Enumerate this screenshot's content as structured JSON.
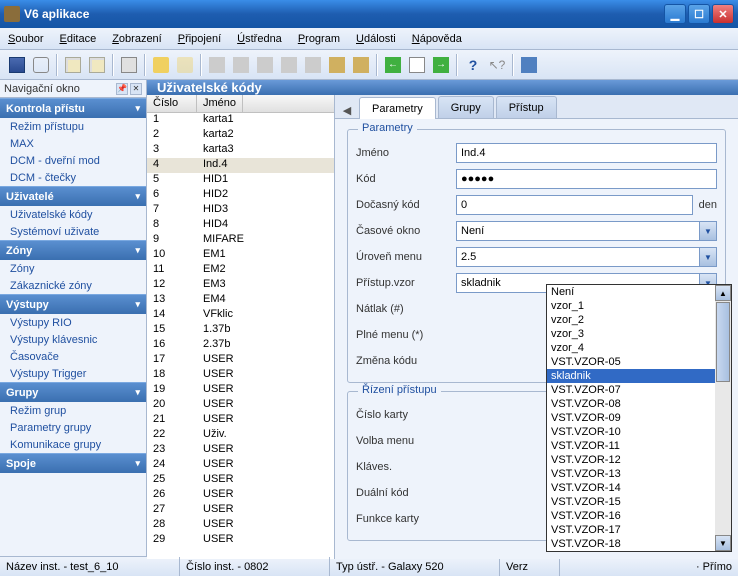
{
  "window": {
    "title": "V6 aplikace"
  },
  "menu": {
    "items": [
      "Soubor",
      "Editace",
      "Zobrazení",
      "Připojení",
      "Ústředna",
      "Program",
      "Události",
      "Nápověda"
    ]
  },
  "nav": {
    "title": "Navigační okno",
    "sections": [
      {
        "title": "Kontrola přístu",
        "items": [
          "Režim přístupu",
          "MAX",
          "DCM - dveřní mod",
          "DCM - čtečky"
        ]
      },
      {
        "title": "Uživatelé",
        "items": [
          "Uživatelské kódy",
          "Systémoví uživate"
        ]
      },
      {
        "title": "Zóny",
        "items": [
          "Zóny",
          "Zákaznické zóny"
        ]
      },
      {
        "title": "Výstupy",
        "items": [
          "Výstupy RIO",
          "Výstupy klávesnic",
          "Časovače",
          "Výstupy Trigger"
        ]
      },
      {
        "title": "Grupy",
        "items": [
          "Režim grup",
          "Parametry grupy",
          "Komunikace grupy"
        ]
      },
      {
        "title": "Spoje",
        "items": []
      }
    ]
  },
  "content": {
    "title": "Uživatelské kódy"
  },
  "list": {
    "col1": "Číslo",
    "col2": "Jméno",
    "rows": [
      {
        "n": "1",
        "name": "karta1"
      },
      {
        "n": "2",
        "name": "karta2"
      },
      {
        "n": "3",
        "name": "karta3"
      },
      {
        "n": "4",
        "name": "Ind.4"
      },
      {
        "n": "5",
        "name": "HID1"
      },
      {
        "n": "6",
        "name": "HID2"
      },
      {
        "n": "7",
        "name": "HID3"
      },
      {
        "n": "8",
        "name": "HID4"
      },
      {
        "n": "9",
        "name": "MIFARE"
      },
      {
        "n": "10",
        "name": "EM1"
      },
      {
        "n": "11",
        "name": "EM2"
      },
      {
        "n": "12",
        "name": "EM3"
      },
      {
        "n": "13",
        "name": "EM4"
      },
      {
        "n": "14",
        "name": "VFklic"
      },
      {
        "n": "15",
        "name": "1.37b"
      },
      {
        "n": "16",
        "name": "2.37b"
      },
      {
        "n": "17",
        "name": "USER"
      },
      {
        "n": "18",
        "name": "USER"
      },
      {
        "n": "19",
        "name": "USER"
      },
      {
        "n": "20",
        "name": "USER"
      },
      {
        "n": "21",
        "name": "USER"
      },
      {
        "n": "22",
        "name": "Uživ."
      },
      {
        "n": "23",
        "name": "USER"
      },
      {
        "n": "24",
        "name": "USER"
      },
      {
        "n": "25",
        "name": "USER"
      },
      {
        "n": "26",
        "name": "USER"
      },
      {
        "n": "27",
        "name": "USER"
      },
      {
        "n": "28",
        "name": "USER"
      },
      {
        "n": "29",
        "name": "USER"
      }
    ],
    "selected": 3
  },
  "tabs": {
    "items": [
      "Parametry",
      "Grupy",
      "Přístup"
    ],
    "active": 0
  },
  "form": {
    "fs1_title": "Parametry",
    "fs2_title": "Řízení přístupu",
    "jmeno_lbl": "Jméno",
    "jmeno_val": "Ind.4",
    "kod_lbl": "Kód",
    "kod_val": "●●●●●",
    "docasny_lbl": "Dočasný kód",
    "docasny_val": "0",
    "docasny_unit": "den",
    "casove_lbl": "Časové okno",
    "casove_val": "Není",
    "uroven_lbl": "Úroveň menu",
    "uroven_val": "2.5",
    "pristup_lbl": "Přístup.vzor",
    "pristup_val": "skladnik",
    "natlak_lbl": "Nátlak (#)",
    "plne_lbl": "Plné menu (*)",
    "zmena_lbl": "Změna kódu",
    "cislo_lbl": "Číslo karty",
    "volba_lbl": "Volba menu",
    "klaves_lbl": "Kláves.",
    "dualni_lbl": "Duální kód",
    "funkce_lbl": "Funkce karty"
  },
  "dropdown": {
    "options": [
      "Není",
      "vzor_1",
      "vzor_2",
      "vzor_3",
      "vzor_4",
      "VST.VZOR-05",
      "skladnik",
      "VST.VZOR-07",
      "VST.VZOR-08",
      "VST.VZOR-09",
      "VST.VZOR-10",
      "VST.VZOR-11",
      "VST.VZOR-12",
      "VST.VZOR-13",
      "VST.VZOR-14",
      "VST.VZOR-15",
      "VST.VZOR-16",
      "VST.VZOR-17",
      "VST.VZOR-18"
    ],
    "selected": 6
  },
  "status": {
    "inst": "Název inst. - test_6_10",
    "cislo": "Číslo inst. - 0802",
    "typ": "Typ ústř. - Galaxy 520",
    "verz": "Verz",
    "primo": "· Přímo"
  }
}
